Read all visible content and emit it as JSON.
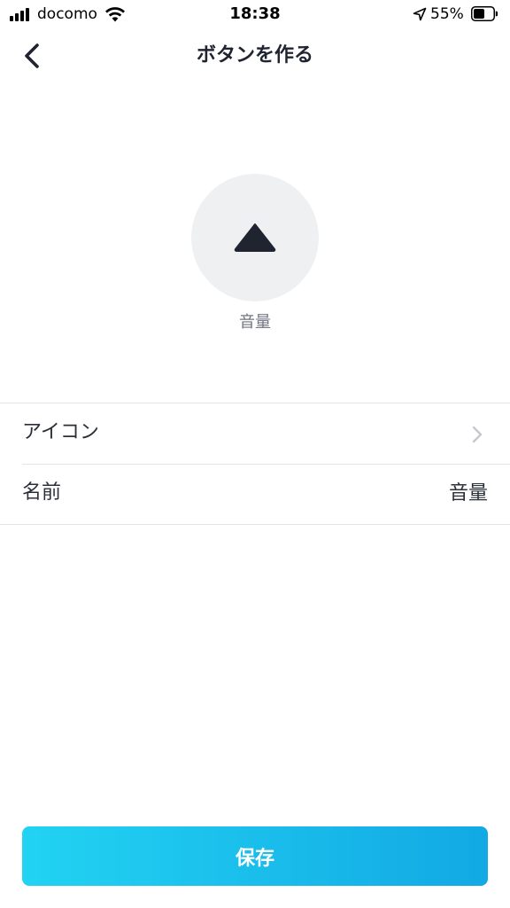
{
  "status_bar": {
    "carrier": "docomo",
    "time": "18:38",
    "battery_percent": "55%",
    "icons": [
      "signal-icon",
      "wifi-icon",
      "location-icon",
      "battery-icon"
    ]
  },
  "nav": {
    "back_icon": "chevron-left-icon",
    "title": "ボタンを作る"
  },
  "preview": {
    "icon": "triangle-up-icon",
    "label": "音量"
  },
  "settings": {
    "icon_row": {
      "label": "アイコン",
      "chevron_icon": "chevron-right-icon"
    },
    "name_row": {
      "label": "名前",
      "value": "音量"
    }
  },
  "footer": {
    "save_label": "保存"
  },
  "colors": {
    "accent_start": "#22d3f2",
    "accent_end": "#12a9e4",
    "preview_bg": "#eff0f2",
    "icon_dark": "#1f2430",
    "divider": "#e3e4e6"
  }
}
